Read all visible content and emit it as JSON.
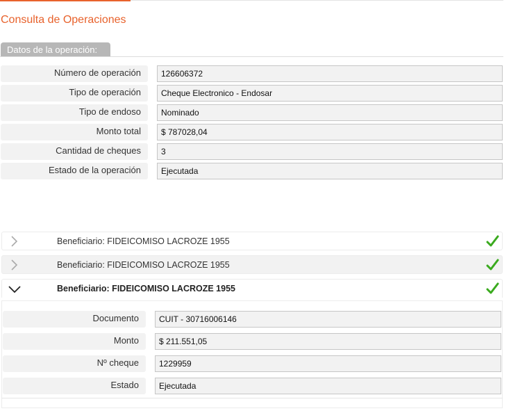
{
  "page": {
    "title": "Consulta de Operaciones",
    "accent_color": "#e8622c",
    "success_color": "#3aaa1e"
  },
  "operation": {
    "section_label": "Datos de la operación:",
    "fields": [
      {
        "label": "Número de operación",
        "value": "126606372"
      },
      {
        "label": "Tipo de operación",
        "value": "Cheque Electronico - Endosar"
      },
      {
        "label": "Tipo de endoso",
        "value": "Nominado"
      },
      {
        "label": "Monto total",
        "value": "$ 787028,04"
      },
      {
        "label": "Cantidad de cheques",
        "value": "3"
      },
      {
        "label": "Estado de la operación",
        "value": "Ejecutada"
      }
    ]
  },
  "beneficiaries": [
    {
      "title": "Beneficiario: FIDEICOMISO LACROZE 1955",
      "expanded": false,
      "status_icon": "check-icon"
    },
    {
      "title": "Beneficiario: FIDEICOMISO LACROZE 1955",
      "expanded": false,
      "status_icon": "check-icon"
    },
    {
      "title": "Beneficiario: FIDEICOMISO LACROZE 1955",
      "expanded": true,
      "status_icon": "check-icon",
      "details": [
        {
          "label": "Documento",
          "value": "CUIT - 30716006146"
        },
        {
          "label": "Monto",
          "value": "$ 211.551,05"
        },
        {
          "label": "Nº cheque",
          "value": "1229959"
        },
        {
          "label": "Estado",
          "value": "Ejecutada"
        }
      ]
    }
  ]
}
